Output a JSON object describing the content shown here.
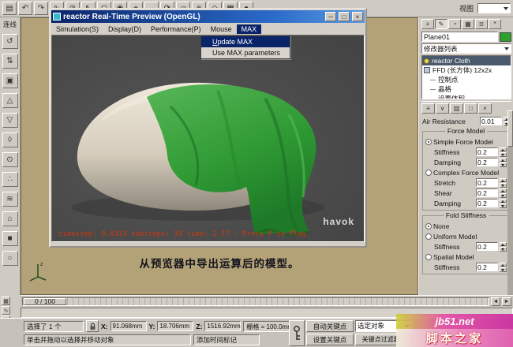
{
  "icons": {
    "top": [
      "▤",
      "↶",
      "↷",
      "∿",
      "⊘",
      "↖",
      "◻",
      "◉",
      "+",
      "↔",
      "⟳",
      "▱",
      "≡",
      "◇",
      "▦",
      "●"
    ],
    "left": [
      "↺",
      "⇅",
      "▣",
      "△",
      "▽",
      "◊",
      "⊙",
      "∴",
      "≋",
      "⌂",
      "■",
      "○"
    ],
    "tabs": [
      "+",
      "✎",
      "◔",
      "▦",
      "≣",
      "*"
    ],
    "stack_tools": [
      "≡",
      "∨",
      "▥",
      "□",
      "×"
    ],
    "corner": [
      "▦",
      "∿",
      "▭"
    ],
    "timeline_prev": "◄",
    "timeline_next": "►",
    "win_min": "─",
    "win_max": "□",
    "win_close": "×"
  },
  "top_toolbar": {
    "view_label": "视图"
  },
  "left_toolbar": {
    "label": "连线"
  },
  "preview_window": {
    "title": "reactor Real-Time Preview (OpenGL)",
    "menus": [
      "Simulation(S)",
      "Display(D)",
      "Performance(P)",
      "Mouse",
      "MAX"
    ],
    "menu_dropdown": [
      "Update MAX",
      "Use MAX parameters"
    ],
    "status_text": "timestep: 0.0333 substeps: 10 time: 2.77 - Press P to Play",
    "logo_text": "havok"
  },
  "viewport": {
    "caption": "从预览器中导出运算后的模型。",
    "axis_label": "z"
  },
  "right_panel": {
    "object_name": "Plane01",
    "modifier_list_label": "修改器列表",
    "modifier_stack": [
      {
        "label": "reactor Cloth"
      },
      {
        "label": "FFD (长方体) 12x2x"
      },
      {
        "label": "控制点"
      },
      {
        "label": "晶格"
      },
      {
        "label": "设置体积"
      }
    ],
    "air_resistance_label": "Air Resistance",
    "air_resistance_value": "0.01",
    "force_model": {
      "title": "Force Model",
      "simple_label": "Simple Force Model",
      "simple_stiffness_label": "Stiffness",
      "simple_stiffness_value": "0.2",
      "simple_damping_label": "Damping",
      "simple_damping_value": "0.2",
      "complex_label": "Complex Force Model",
      "stretch_label": "Stretch",
      "stretch_value": "0.2",
      "shear_label": "Shear",
      "shear_value": "0.2",
      "complex_damping_label": "Damping",
      "complex_damping_value": "0.2"
    },
    "fold_stiffness": {
      "title": "Fold Stiffness",
      "none_label": "None",
      "uniform_label": "Uniform Model",
      "uniform_stiffness_label": "Stiffness",
      "uniform_stiffness_value": "0.2",
      "spatial_label": "Spatial Model",
      "spatial_stiffness_label": "Stiffness",
      "spatial_stiffness_value": "0.2"
    }
  },
  "timeline": {
    "handle_label": "0 / 100"
  },
  "status_bar": {
    "selection_text": "选择了 1 个",
    "x_label": "X:",
    "x_value": "91.068mm",
    "y_label": "Y:",
    "y_value": "18.706mm",
    "z_label": "Z:",
    "z_value": "1516.92mm",
    "grid_text": "栅格 = 100.0mm",
    "prompt_text": "单击并拖动以选择并移动对象",
    "time_tag_text": "添加时间标记",
    "auto_key_label": "自动关键点",
    "set_key_label": "设置关键点",
    "selected_object_label": "选定对象",
    "key_filters_label": "关键点过滤器..."
  },
  "watermark": {
    "line1": "jb51.net",
    "line2": "脚本之家"
  }
}
